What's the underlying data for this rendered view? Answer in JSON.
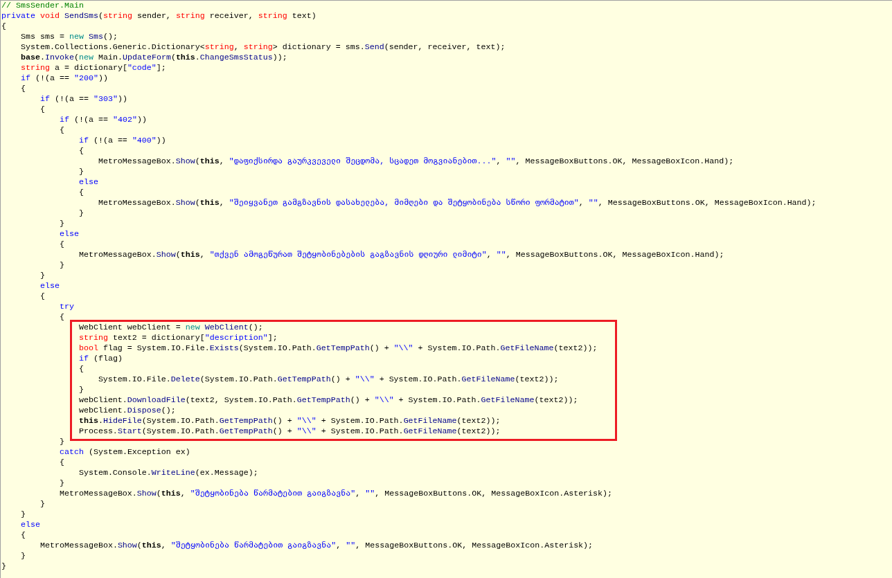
{
  "code_blocks": [
    {
      "highlighted": false,
      "lines": [
        [
          {
            "kind": "comment",
            "text": "// SmsSender.Main"
          }
        ],
        [
          {
            "kind": "keyword",
            "text": "private "
          },
          {
            "kind": "type",
            "text": "void "
          },
          {
            "kind": "member",
            "text": "SendSms"
          },
          {
            "kind": "plain",
            "text": "("
          },
          {
            "kind": "type",
            "text": "string"
          },
          {
            "kind": "plain",
            "text": " sender, "
          },
          {
            "kind": "type",
            "text": "string"
          },
          {
            "kind": "plain",
            "text": " receiver, "
          },
          {
            "kind": "type",
            "text": "string"
          },
          {
            "kind": "plain",
            "text": " text)"
          }
        ],
        [
          {
            "kind": "plain",
            "text": "{"
          }
        ],
        [
          {
            "kind": "plain",
            "text": "    Sms sms = "
          },
          {
            "kind": "new",
            "text": "new "
          },
          {
            "kind": "member",
            "text": "Sms"
          },
          {
            "kind": "plain",
            "text": "();"
          }
        ],
        [
          {
            "kind": "plain",
            "text": "    System.Collections.Generic.Dictionary<"
          },
          {
            "kind": "type",
            "text": "string"
          },
          {
            "kind": "plain",
            "text": ", "
          },
          {
            "kind": "type",
            "text": "string"
          },
          {
            "kind": "plain",
            "text": "> dictionary = sms."
          },
          {
            "kind": "member",
            "text": "Send"
          },
          {
            "kind": "plain",
            "text": "(sender, receiver, text);"
          }
        ],
        [
          {
            "kind": "bold",
            "text": "    base"
          },
          {
            "kind": "plain",
            "text": "."
          },
          {
            "kind": "member",
            "text": "Invoke"
          },
          {
            "kind": "plain",
            "text": "("
          },
          {
            "kind": "new",
            "text": "new"
          },
          {
            "kind": "plain",
            "text": " Main."
          },
          {
            "kind": "member",
            "text": "UpdateForm"
          },
          {
            "kind": "plain",
            "text": "("
          },
          {
            "kind": "bold",
            "text": "this"
          },
          {
            "kind": "plain",
            "text": "."
          },
          {
            "kind": "member",
            "text": "ChangeSmsStatus"
          },
          {
            "kind": "plain",
            "text": "));"
          }
        ],
        [
          {
            "kind": "type",
            "text": "    string"
          },
          {
            "kind": "plain",
            "text": " a = dictionary["
          },
          {
            "kind": "string",
            "text": "\"code\""
          },
          {
            "kind": "plain",
            "text": "];"
          }
        ],
        [
          {
            "kind": "keyword",
            "text": "    if"
          },
          {
            "kind": "plain",
            "text": " (!(a == "
          },
          {
            "kind": "string",
            "text": "\"200\""
          },
          {
            "kind": "plain",
            "text": "))"
          }
        ],
        [
          {
            "kind": "plain",
            "text": "    {"
          }
        ],
        [
          {
            "kind": "keyword",
            "text": "        if"
          },
          {
            "kind": "plain",
            "text": " (!(a == "
          },
          {
            "kind": "string",
            "text": "\"303\""
          },
          {
            "kind": "plain",
            "text": "))"
          }
        ],
        [
          {
            "kind": "plain",
            "text": "        {"
          }
        ],
        [
          {
            "kind": "keyword",
            "text": "            if"
          },
          {
            "kind": "plain",
            "text": " (!(a == "
          },
          {
            "kind": "string",
            "text": "\"402\""
          },
          {
            "kind": "plain",
            "text": "))"
          }
        ],
        [
          {
            "kind": "plain",
            "text": "            {"
          }
        ],
        [
          {
            "kind": "keyword",
            "text": "                if"
          },
          {
            "kind": "plain",
            "text": " (!(a == "
          },
          {
            "kind": "string",
            "text": "\"400\""
          },
          {
            "kind": "plain",
            "text": "))"
          }
        ],
        [
          {
            "kind": "plain",
            "text": "                {"
          }
        ],
        [
          {
            "kind": "plain",
            "text": "                    MetroMessageBox."
          },
          {
            "kind": "member",
            "text": "Show"
          },
          {
            "kind": "plain",
            "text": "("
          },
          {
            "kind": "bold",
            "text": "this"
          },
          {
            "kind": "plain",
            "text": ", "
          },
          {
            "kind": "string",
            "text": "\"დაფიქსირდა გაურკვეველი შეცდომა, სცადეთ მოგვიანებით...\""
          },
          {
            "kind": "plain",
            "text": ", "
          },
          {
            "kind": "string",
            "text": "\"\""
          },
          {
            "kind": "plain",
            "text": ", MessageBoxButtons.OK, MessageBoxIcon.Hand);"
          }
        ],
        [
          {
            "kind": "plain",
            "text": "                }"
          }
        ],
        [
          {
            "kind": "keyword",
            "text": "                else"
          }
        ],
        [
          {
            "kind": "plain",
            "text": "                {"
          }
        ],
        [
          {
            "kind": "plain",
            "text": "                    MetroMessageBox."
          },
          {
            "kind": "member",
            "text": "Show"
          },
          {
            "kind": "plain",
            "text": "("
          },
          {
            "kind": "bold",
            "text": "this"
          },
          {
            "kind": "plain",
            "text": ", "
          },
          {
            "kind": "string",
            "text": "\"შეიყვანეთ გამგზავნის დასახელება, მიმღები და შეტყობინება სწორი ფორმატით\""
          },
          {
            "kind": "plain",
            "text": ", "
          },
          {
            "kind": "string",
            "text": "\"\""
          },
          {
            "kind": "plain",
            "text": ", MessageBoxButtons.OK, MessageBoxIcon.Hand);"
          }
        ],
        [
          {
            "kind": "plain",
            "text": "                }"
          }
        ],
        [
          {
            "kind": "plain",
            "text": "            }"
          }
        ],
        [
          {
            "kind": "keyword",
            "text": "            else"
          }
        ],
        [
          {
            "kind": "plain",
            "text": "            {"
          }
        ],
        [
          {
            "kind": "plain",
            "text": "                MetroMessageBox."
          },
          {
            "kind": "member",
            "text": "Show"
          },
          {
            "kind": "plain",
            "text": "("
          },
          {
            "kind": "bold",
            "text": "this"
          },
          {
            "kind": "plain",
            "text": ", "
          },
          {
            "kind": "string",
            "text": "\"თქვენ ამოგეწურათ შეტყობინებების გაგზავნის დღიური ლიმიტი\""
          },
          {
            "kind": "plain",
            "text": ", "
          },
          {
            "kind": "string",
            "text": "\"\""
          },
          {
            "kind": "plain",
            "text": ", MessageBoxButtons.OK, MessageBoxIcon.Hand);"
          }
        ],
        [
          {
            "kind": "plain",
            "text": "            }"
          }
        ],
        [
          {
            "kind": "plain",
            "text": "        }"
          }
        ],
        [
          {
            "kind": "keyword",
            "text": "        else"
          }
        ],
        [
          {
            "kind": "plain",
            "text": "        {"
          }
        ],
        [
          {
            "kind": "keyword",
            "text": "            try"
          }
        ],
        [
          {
            "kind": "plain",
            "text": "            {"
          }
        ]
      ]
    },
    {
      "highlighted": true,
      "lines": [
        [
          {
            "kind": "plain",
            "text": "                WebClient webClient = "
          },
          {
            "kind": "new",
            "text": "new "
          },
          {
            "kind": "member",
            "text": "WebClient"
          },
          {
            "kind": "plain",
            "text": "();"
          }
        ],
        [
          {
            "kind": "type",
            "text": "                string"
          },
          {
            "kind": "plain",
            "text": " text2 = dictionary["
          },
          {
            "kind": "string",
            "text": "\"description\""
          },
          {
            "kind": "plain",
            "text": "];"
          }
        ],
        [
          {
            "kind": "type",
            "text": "                bool"
          },
          {
            "kind": "plain",
            "text": " flag = System.IO.File."
          },
          {
            "kind": "member",
            "text": "Exists"
          },
          {
            "kind": "plain",
            "text": "(System.IO.Path."
          },
          {
            "kind": "member",
            "text": "GetTempPath"
          },
          {
            "kind": "plain",
            "text": "() + "
          },
          {
            "kind": "string",
            "text": "\"\\\\\""
          },
          {
            "kind": "plain",
            "text": " + System.IO.Path."
          },
          {
            "kind": "member",
            "text": "GetFileName"
          },
          {
            "kind": "plain",
            "text": "(text2));"
          }
        ],
        [
          {
            "kind": "keyword",
            "text": "                if"
          },
          {
            "kind": "plain",
            "text": " (flag)"
          }
        ],
        [
          {
            "kind": "plain",
            "text": "                {"
          }
        ],
        [
          {
            "kind": "plain",
            "text": "                    System.IO.File."
          },
          {
            "kind": "member",
            "text": "Delete"
          },
          {
            "kind": "plain",
            "text": "(System.IO.Path."
          },
          {
            "kind": "member",
            "text": "GetTempPath"
          },
          {
            "kind": "plain",
            "text": "() + "
          },
          {
            "kind": "string",
            "text": "\"\\\\\""
          },
          {
            "kind": "plain",
            "text": " + System.IO.Path."
          },
          {
            "kind": "member",
            "text": "GetFileName"
          },
          {
            "kind": "plain",
            "text": "(text2));"
          }
        ],
        [
          {
            "kind": "plain",
            "text": "                }"
          }
        ],
        [
          {
            "kind": "plain",
            "text": "                webClient."
          },
          {
            "kind": "member",
            "text": "DownloadFile"
          },
          {
            "kind": "plain",
            "text": "(text2, System.IO.Path."
          },
          {
            "kind": "member",
            "text": "GetTempPath"
          },
          {
            "kind": "plain",
            "text": "() + "
          },
          {
            "kind": "string",
            "text": "\"\\\\\""
          },
          {
            "kind": "plain",
            "text": " + System.IO.Path."
          },
          {
            "kind": "member",
            "text": "GetFileName"
          },
          {
            "kind": "plain",
            "text": "(text2));"
          }
        ],
        [
          {
            "kind": "plain",
            "text": "                webClient."
          },
          {
            "kind": "member",
            "text": "Dispose"
          },
          {
            "kind": "plain",
            "text": "();"
          }
        ],
        [
          {
            "kind": "bold",
            "text": "                this"
          },
          {
            "kind": "plain",
            "text": "."
          },
          {
            "kind": "member",
            "text": "HideFile"
          },
          {
            "kind": "plain",
            "text": "(System.IO.Path."
          },
          {
            "kind": "member",
            "text": "GetTempPath"
          },
          {
            "kind": "plain",
            "text": "() + "
          },
          {
            "kind": "string",
            "text": "\"\\\\\""
          },
          {
            "kind": "plain",
            "text": " + System.IO.Path."
          },
          {
            "kind": "member",
            "text": "GetFileName"
          },
          {
            "kind": "plain",
            "text": "(text2));"
          }
        ],
        [
          {
            "kind": "plain",
            "text": "                Process."
          },
          {
            "kind": "member",
            "text": "Start"
          },
          {
            "kind": "plain",
            "text": "(System.IO.Path."
          },
          {
            "kind": "member",
            "text": "GetTempPath"
          },
          {
            "kind": "plain",
            "text": "() + "
          },
          {
            "kind": "string",
            "text": "\"\\\\\""
          },
          {
            "kind": "plain",
            "text": " + System.IO.Path."
          },
          {
            "kind": "member",
            "text": "GetFileName"
          },
          {
            "kind": "plain",
            "text": "(text2));"
          }
        ]
      ]
    },
    {
      "highlighted": false,
      "lines": [
        [
          {
            "kind": "plain",
            "text": "            }"
          }
        ],
        [
          {
            "kind": "keyword",
            "text": "            catch"
          },
          {
            "kind": "plain",
            "text": " (System.Exception ex)"
          }
        ],
        [
          {
            "kind": "plain",
            "text": "            {"
          }
        ],
        [
          {
            "kind": "plain",
            "text": "                System.Console."
          },
          {
            "kind": "member",
            "text": "WriteLine"
          },
          {
            "kind": "plain",
            "text": "(ex.Message);"
          }
        ],
        [
          {
            "kind": "plain",
            "text": "            }"
          }
        ],
        [
          {
            "kind": "plain",
            "text": "            MetroMessageBox."
          },
          {
            "kind": "member",
            "text": "Show"
          },
          {
            "kind": "plain",
            "text": "("
          },
          {
            "kind": "bold",
            "text": "this"
          },
          {
            "kind": "plain",
            "text": ", "
          },
          {
            "kind": "string",
            "text": "\"შეტყობინება წარმატებით გაიგზავნა\""
          },
          {
            "kind": "plain",
            "text": ", "
          },
          {
            "kind": "string",
            "text": "\"\""
          },
          {
            "kind": "plain",
            "text": ", MessageBoxButtons.OK, MessageBoxIcon.Asterisk);"
          }
        ],
        [
          {
            "kind": "plain",
            "text": "        }"
          }
        ],
        [
          {
            "kind": "plain",
            "text": "    }"
          }
        ],
        [
          {
            "kind": "keyword",
            "text": "    else"
          }
        ],
        [
          {
            "kind": "plain",
            "text": "    {"
          }
        ],
        [
          {
            "kind": "plain",
            "text": "        MetroMessageBox."
          },
          {
            "kind": "member",
            "text": "Show"
          },
          {
            "kind": "plain",
            "text": "("
          },
          {
            "kind": "bold",
            "text": "this"
          },
          {
            "kind": "plain",
            "text": ", "
          },
          {
            "kind": "string",
            "text": "\"შეტყობინება წარმატებით გაიგზავნა\""
          },
          {
            "kind": "plain",
            "text": ", "
          },
          {
            "kind": "string",
            "text": "\"\""
          },
          {
            "kind": "plain",
            "text": ", MessageBoxButtons.OK, MessageBoxIcon.Asterisk);"
          }
        ],
        [
          {
            "kind": "plain",
            "text": "    }"
          }
        ],
        [
          {
            "kind": "plain",
            "text": "}"
          }
        ]
      ]
    }
  ]
}
